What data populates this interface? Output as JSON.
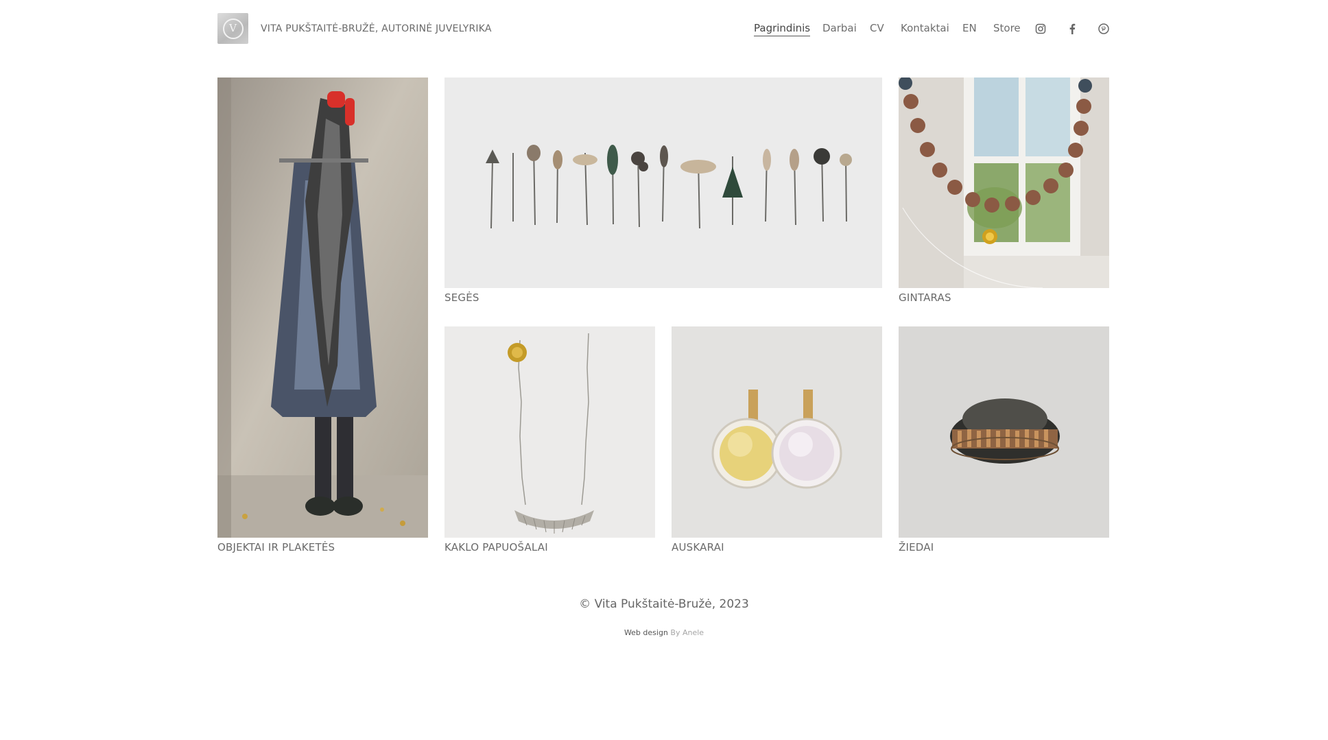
{
  "header": {
    "site_title": "VITA PUKŠTAITĖ-BRUŽĖ, AUTORINĖ JUVELYRIKA",
    "logo_letter": "V",
    "nav": [
      {
        "label": "Pagrindinis",
        "active": true
      },
      {
        "label": "Darbai"
      },
      {
        "label": "CV"
      },
      {
        "label": "Kontaktai"
      },
      {
        "label": "EN"
      },
      {
        "label": "Store"
      }
    ],
    "social_icons": [
      "instagram-icon",
      "facebook-icon",
      "pinterest-icon"
    ]
  },
  "gallery": {
    "items": [
      {
        "caption": "OBJEKTAI IR PLAKETĖS"
      },
      {
        "caption": "SEGĖS"
      },
      {
        "caption": "GINTARAS"
      },
      {
        "caption": "KAKLO PAPUOŠALAI"
      },
      {
        "caption": "AUSKARAI"
      },
      {
        "caption": "ŽIEDAI"
      }
    ]
  },
  "footer": {
    "copyright": "© Vita Pukštaitė-Bružė, 2023",
    "credit_label": "Web design",
    "credit_by": "By Anele"
  },
  "colors": {
    "background": "#ffffff",
    "text": "#6a6a6a",
    "accent_underline": "#555555"
  }
}
